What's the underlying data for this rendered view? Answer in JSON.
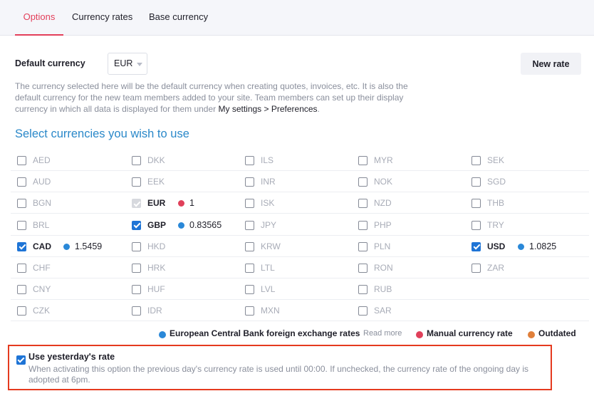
{
  "tabs": [
    {
      "label": "Options",
      "active": true
    },
    {
      "label": "Currency rates",
      "active": false
    },
    {
      "label": "Base currency",
      "active": false
    }
  ],
  "default_currency": {
    "label": "Default currency",
    "value": "EUR",
    "description": "The currency selected here will be the default currency when creating quotes, invoices, etc. It is also the default currency for the new team members added to your site. Team members can set up their display currency in which all data is displayed for them under ",
    "link_text": "My settings > Preferences",
    "description_end": "."
  },
  "new_rate_label": "New rate",
  "section_title": "Select currencies you wish to use",
  "colors": {
    "ecb": "#2a88d8",
    "manual": "#e0405a",
    "outdated": "#e07f3a",
    "accent": "#e33f5a",
    "checkbox": "#1e74d6"
  },
  "currency_columns": [
    [
      {
        "code": "AED",
        "checked": false
      },
      {
        "code": "AUD",
        "checked": false
      },
      {
        "code": "BGN",
        "checked": false
      },
      {
        "code": "BRL",
        "checked": false
      },
      {
        "code": "CAD",
        "checked": true,
        "rate": "1.5459",
        "source": "ecb"
      },
      {
        "code": "CHF",
        "checked": false
      },
      {
        "code": "CNY",
        "checked": false
      },
      {
        "code": "CZK",
        "checked": false
      }
    ],
    [
      {
        "code": "DKK",
        "checked": false
      },
      {
        "code": "EEK",
        "checked": false
      },
      {
        "code": "EUR",
        "checked": true,
        "disabled": true,
        "rate": "1",
        "source": "manual"
      },
      {
        "code": "GBP",
        "checked": true,
        "rate": "0.83565",
        "source": "ecb"
      },
      {
        "code": "HKD",
        "checked": false
      },
      {
        "code": "HRK",
        "checked": false
      },
      {
        "code": "HUF",
        "checked": false
      },
      {
        "code": "IDR",
        "checked": false
      }
    ],
    [
      {
        "code": "ILS",
        "checked": false
      },
      {
        "code": "INR",
        "checked": false
      },
      {
        "code": "ISK",
        "checked": false
      },
      {
        "code": "JPY",
        "checked": false
      },
      {
        "code": "KRW",
        "checked": false
      },
      {
        "code": "LTL",
        "checked": false
      },
      {
        "code": "LVL",
        "checked": false
      },
      {
        "code": "MXN",
        "checked": false
      }
    ],
    [
      {
        "code": "MYR",
        "checked": false
      },
      {
        "code": "NOK",
        "checked": false
      },
      {
        "code": "NZD",
        "checked": false
      },
      {
        "code": "PHP",
        "checked": false
      },
      {
        "code": "PLN",
        "checked": false
      },
      {
        "code": "RON",
        "checked": false
      },
      {
        "code": "RUB",
        "checked": false
      },
      {
        "code": "SAR",
        "checked": false
      }
    ],
    [
      {
        "code": "SEK",
        "checked": false
      },
      {
        "code": "SGD",
        "checked": false
      },
      {
        "code": "THB",
        "checked": false
      },
      {
        "code": "TRY",
        "checked": false
      },
      {
        "code": "USD",
        "checked": true,
        "rate": "1.0825",
        "source": "ecb"
      },
      {
        "code": "ZAR",
        "checked": false
      }
    ]
  ],
  "legend": {
    "ecb": "European Central Bank foreign exchange rates",
    "read_more": "Read more",
    "manual": "Manual currency rate",
    "outdated": "Outdated"
  },
  "yesterday": {
    "checked": true,
    "title": "Use yesterday's rate",
    "description": "When activating this option the previous day's currency rate is used until 00:00. If unchecked, the currency rate of the ongoing day is adopted at 6pm."
  }
}
